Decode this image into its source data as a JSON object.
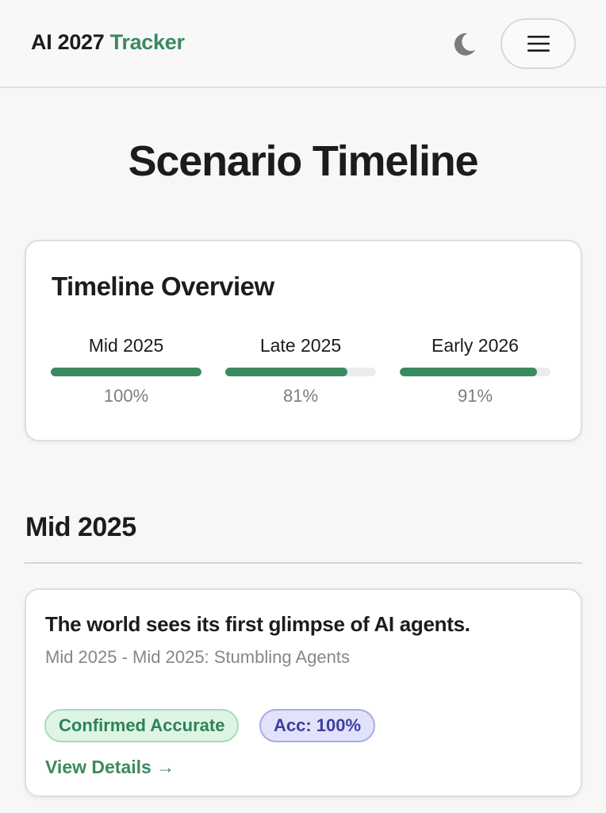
{
  "header": {
    "brand_prefix": "AI 2027",
    "brand_accent": "Tracker",
    "theme_icon": "moon-icon",
    "menu_icon": "hamburger-icon"
  },
  "page": {
    "title": "Scenario Timeline"
  },
  "overview": {
    "title": "Timeline Overview",
    "periods": [
      {
        "label": "Mid 2025",
        "progress": 100,
        "progress_text": "100%"
      },
      {
        "label": "Late 2025",
        "progress": 81,
        "progress_text": "81%"
      },
      {
        "label": "Early 2026",
        "progress": 91,
        "progress_text": "91%"
      }
    ]
  },
  "section": {
    "heading": "Mid 2025",
    "events": [
      {
        "title": "The world sees its first glimpse of AI agents.",
        "subtitle": "Mid 2025 - Mid 2025: Stumbling Agents",
        "status_badge": "Confirmed Accurate",
        "accuracy_badge": "Acc: 100%",
        "link_label": "View Details →"
      }
    ]
  },
  "colors": {
    "accent": "#3a8a5f",
    "badge_green_bg": "#def5e6",
    "badge_purple_bg": "#e2e3fa"
  }
}
